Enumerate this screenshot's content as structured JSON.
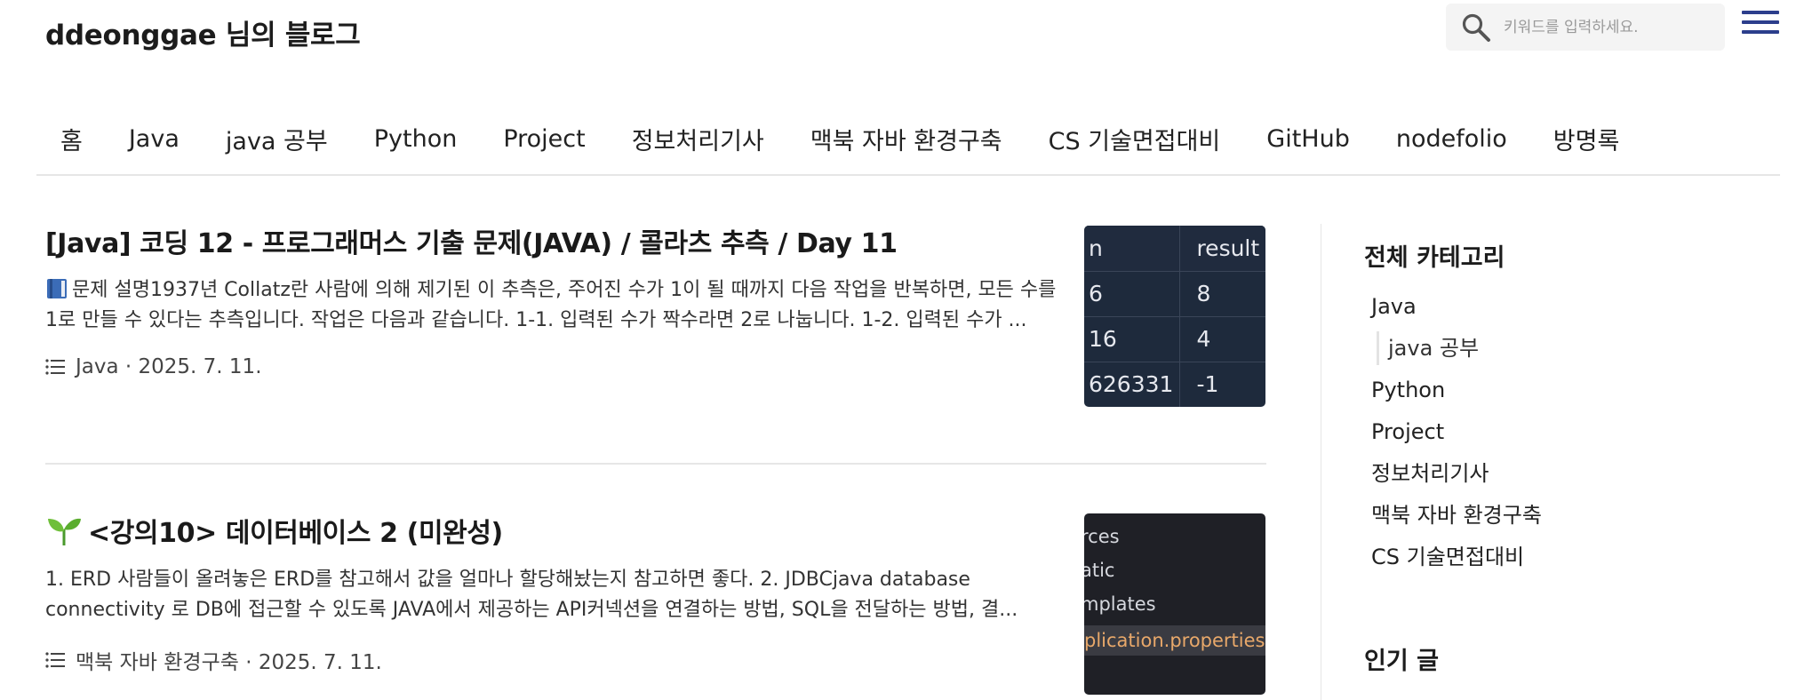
{
  "header": {
    "site_title": "ddeonggae 님의 블로그",
    "search_placeholder": "키워드를 입력하세요."
  },
  "nav": {
    "items": [
      "홈",
      "Java",
      "java 공부",
      "Python",
      "Project",
      "정보처리기사",
      "맥북 자바 환경구축",
      "CS 기술면접대비",
      "GitHub",
      "nodefolio",
      "방명록"
    ]
  },
  "posts": [
    {
      "title": "[Java] 코딩 12 - 프로그래머스 기출 문제(JAVA) / 콜라츠 추측 / Day 11",
      "excerpt": "문제 설명1937년 Collatz란 사람에 의해 제기된 이 추측은, 주어진 수가 1이 될 때까지 다음 작업을 반복하면, 모든 수를 1로 만들 수 있다는 추측입니다. 작업은 다음과 같습니다. 1-1. 입력된 수가 짝수라면 2로 나눕니다. 1-2. 입력된 수가 ...",
      "category": "Java",
      "date": "2025. 7. 11.",
      "meta": "Java · 2025. 7. 11.",
      "thumb_table": {
        "header": [
          "n",
          "result"
        ],
        "rows": [
          [
            "6",
            "8"
          ],
          [
            "16",
            "4"
          ],
          [
            "626331",
            "-1"
          ]
        ]
      }
    },
    {
      "title": "<강의10> 데이터베이스 2 (미완성)",
      "excerpt": "1. ERD 사람들이 올려놓은 ERD를 참고해서 값을 얼마나 할당해놨는지 참고하면 좋다. 2. JDBCjava database connectivity 로 DB에 접근할 수 있도록 JAVA에서 제공하는 API커넥션을 연결하는 방법, SQL을 전달하는 방법, 결...",
      "category": "맥북 자바 환경구축",
      "date": "2025. 7. 11.",
      "meta": "맥북 자바 환경구축 · 2025. 7. 11.",
      "thumb_lines": [
        "rces",
        "atic",
        "mplates",
        "plication.properties"
      ]
    }
  ],
  "sidebar": {
    "categories_title": "전체 카테고리",
    "categories": [
      {
        "label": "Java",
        "sub": false
      },
      {
        "label": "java 공부",
        "sub": true
      },
      {
        "label": "Python",
        "sub": false
      },
      {
        "label": "Project",
        "sub": false
      },
      {
        "label": "정보처리기사",
        "sub": false
      },
      {
        "label": "맥북 자바 환경구축",
        "sub": false
      },
      {
        "label": "CS 기술면접대비",
        "sub": false
      }
    ],
    "popular_title": "인기 글"
  },
  "colors": {
    "menu_icon": "#2c3e8c",
    "thumb1_bg": "#1e2a3c",
    "thumb2_bg": "#1f2026",
    "thumb2_highlight": "#e8a86a"
  }
}
